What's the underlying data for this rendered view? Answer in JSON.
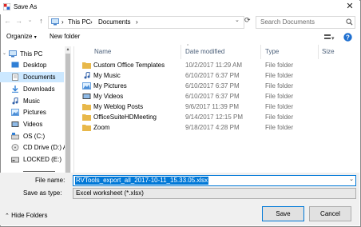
{
  "window": {
    "title": "Save As"
  },
  "address": {
    "root": "This PC",
    "folder": "Documents"
  },
  "search": {
    "placeholder": "Search Documents"
  },
  "toolbar": {
    "organize": "Organize",
    "new_folder": "New folder"
  },
  "sidebar": {
    "items": [
      {
        "label": "This PC",
        "icon": "pc-icon",
        "selected": false,
        "level": 0
      },
      {
        "label": "Desktop",
        "icon": "desktop-icon",
        "selected": false,
        "level": 1
      },
      {
        "label": "Documents",
        "icon": "documents-icon",
        "selected": true,
        "level": 1
      },
      {
        "label": "Downloads",
        "icon": "downloads-icon",
        "selected": false,
        "level": 1
      },
      {
        "label": "Music",
        "icon": "music-icon",
        "selected": false,
        "level": 1
      },
      {
        "label": "Pictures",
        "icon": "pictures-icon",
        "selected": false,
        "level": 1
      },
      {
        "label": "Videos",
        "icon": "videos-icon",
        "selected": false,
        "level": 1
      },
      {
        "label": "OS (C:)",
        "icon": "drive-icon",
        "selected": false,
        "level": 1
      },
      {
        "label": "CD Drive (D:) Ap",
        "icon": "cd-drive-icon",
        "selected": false,
        "level": 1
      },
      {
        "label": "LOCKED (E:)",
        "icon": "drive-icon",
        "selected": false,
        "level": 1
      }
    ]
  },
  "columns": {
    "name": "Name",
    "date": "Date modified",
    "type": "Type",
    "size": "Size"
  },
  "files": [
    {
      "name": "Custom Office Templates",
      "date": "10/2/2017 11:29 AM",
      "type": "File folder",
      "icon": "folder-icon"
    },
    {
      "name": "My Music",
      "date": "6/10/2017 6:37 PM",
      "type": "File folder",
      "icon": "music-folder-icon"
    },
    {
      "name": "My Pictures",
      "date": "6/10/2017 6:37 PM",
      "type": "File folder",
      "icon": "pictures-folder-icon"
    },
    {
      "name": "My Videos",
      "date": "6/10/2017 6:37 PM",
      "type": "File folder",
      "icon": "videos-folder-icon"
    },
    {
      "name": "My Weblog Posts",
      "date": "9/6/2017 11:39 PM",
      "type": "File folder",
      "icon": "folder-icon"
    },
    {
      "name": "OfficeSuiteHDMeeting",
      "date": "9/14/2017 12:15 PM",
      "type": "File folder",
      "icon": "folder-icon"
    },
    {
      "name": "Zoom",
      "date": "9/18/2017 4:28 PM",
      "type": "File folder",
      "icon": "folder-icon"
    }
  ],
  "form": {
    "file_name_label": "File name:",
    "file_name_value": "RVTools_export_all_2017-10-11_15.33.05.xlsx",
    "save_as_type_label": "Save as type:",
    "save_as_type_value": "Excel worksheet (*.xlsx)"
  },
  "footer": {
    "hide_folders": "Hide Folders",
    "save": "Save",
    "cancel": "Cancel"
  },
  "colors": {
    "accent": "#0078d7",
    "selection": "#cce8ff",
    "folder": "#e8b84a"
  }
}
